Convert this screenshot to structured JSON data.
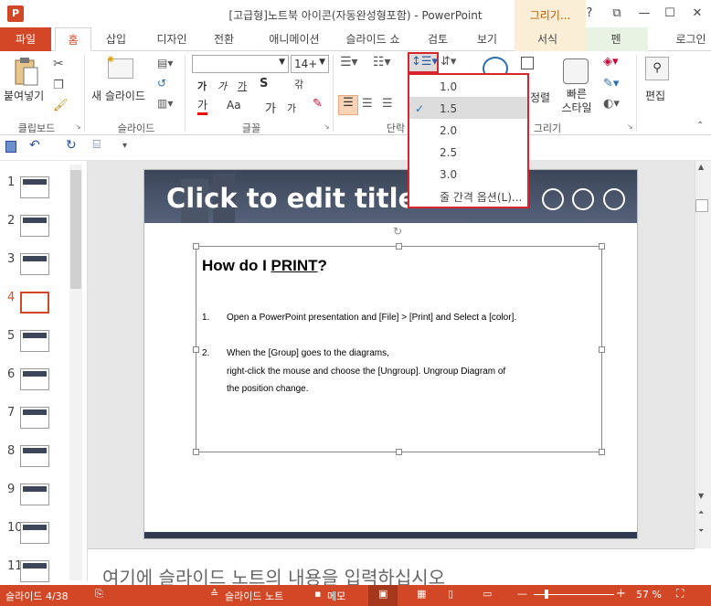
{
  "window": {
    "title": "[고급형]노트북 아이콘(자동완성형포함) - PowerPoint",
    "ctx_tools": "그리기..."
  },
  "window_buttons": {
    "help": "?",
    "restore": "⧉",
    "min": "—",
    "max": "☐",
    "close": "✕"
  },
  "tabs": {
    "file": "파일",
    "home": "홈",
    "insert": "삽입",
    "design": "디자인",
    "transitions": "전환",
    "animations": "애니메이션",
    "slideshow": "슬라이드 쇼",
    "review": "검토",
    "view": "보기",
    "format": "서식",
    "pen": "펜",
    "login": "로그인"
  },
  "ribbon": {
    "paste_label": "붙여넣기",
    "new_slide_label": "새 슬라이드",
    "font_size": "14+",
    "font_name": "",
    "edit_label": "편집",
    "quick_style_label": "빠른\n스타일",
    "arrange_label": "정렬",
    "groups": {
      "clipboard": "클립보드",
      "slides": "슬라이드",
      "font": "글꼴",
      "paragraph": "단락",
      "drawing": "그리기"
    },
    "font_btns": {
      "bold": "가",
      "italic": "가",
      "underline": "가",
      "shadow": "S",
      "spacing": "갂",
      "color": "가",
      "case": "Aa",
      "grow": "가",
      "shrink": "가"
    }
  },
  "line_spacing_menu": {
    "items": [
      "1.0",
      "1.5",
      "2.0",
      "2.5",
      "3.0"
    ],
    "selected": "1.5",
    "options_label": "줄 간격 옵션(L)..."
  },
  "qat": {
    "save": "💾",
    "undo": "↶",
    "redo": "↻",
    "present": "⌸"
  },
  "thumbnails": [
    "1",
    "2",
    "3",
    "4",
    "5",
    "6",
    "7",
    "8",
    "9",
    "10",
    "11"
  ],
  "active_thumbnail": "4",
  "slide": {
    "title": "Click to edit title",
    "heading_plain": "How do I ",
    "heading_link": "PRINT",
    "heading_end": "?",
    "item1_num": "1.",
    "item1": "Open a PowerPoint presentation and  [File] > [Print] and Select a [color].",
    "item2_num": "2.",
    "item2_l1": "When the [Group] goes to the diagrams,",
    "item2_l2": "right-click the mouse and choose the [Ungroup]. Ungroup Diagram of",
    "item2_l3": "the position change."
  },
  "notes": "여기에 슬라이드 노트의 내용을 입력하십시오",
  "status": {
    "slide_count": "슬라이드 4/38",
    "notes_btn": "슬라이드 노트",
    "comments_btn": "메모",
    "zoom": "57 %",
    "minus": "—",
    "plus": "+"
  },
  "colors": {
    "accent": "#d24726",
    "menu_border": "#d8252b"
  }
}
